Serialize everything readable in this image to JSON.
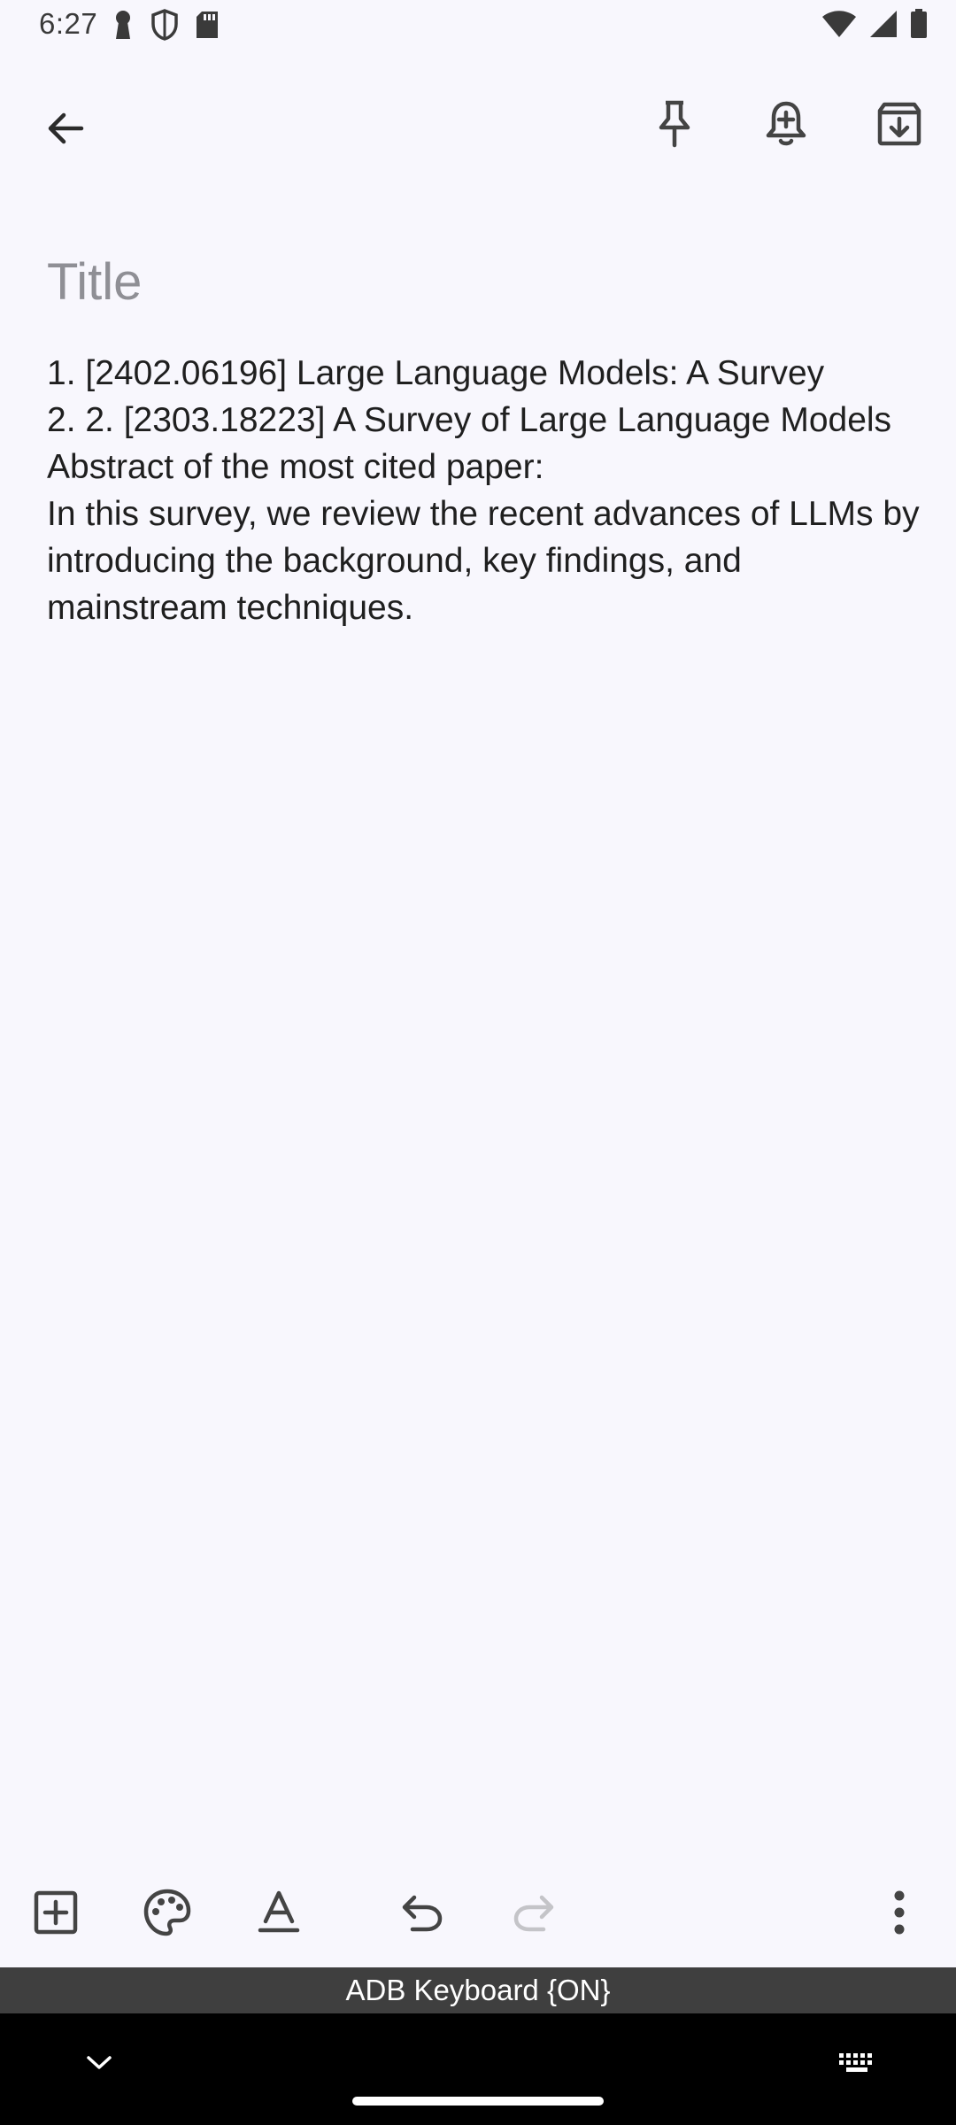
{
  "status_bar": {
    "time": "6:27"
  },
  "toolbar": {
    "back_icon": "arrow-back-icon",
    "pin_icon": "pin-icon",
    "reminder_icon": "bell-plus-icon",
    "archive_icon": "archive-icon"
  },
  "note": {
    "title_placeholder": "Title",
    "title_value": "",
    "lines": [
      "1. [2402.06196] Large Language Models: A Survey",
      "2. 2. [2303.18223] A Survey of Large Language Models",
      "Abstract of the most cited paper:",
      "In this survey, we review the recent advances of LLMs by introducing the background, key findings, and mainstream techniques."
    ]
  },
  "bottom_toolbar": {
    "add_icon": "add-box-icon",
    "palette_icon": "palette-icon",
    "text_format_icon": "text-format-icon",
    "undo_icon": "undo-icon",
    "redo_icon": "redo-icon",
    "more_icon": "more-vert-icon"
  },
  "keyboard": {
    "status_label": "ADB Keyboard {ON}"
  },
  "colors": {
    "background": "#f8f7fd",
    "text": "#1f1f1f",
    "placeholder": "#8f8f95",
    "icon": "#444444",
    "disabled_icon": "#c4c4c8",
    "keyboard_strip": "#3f3f3f"
  }
}
